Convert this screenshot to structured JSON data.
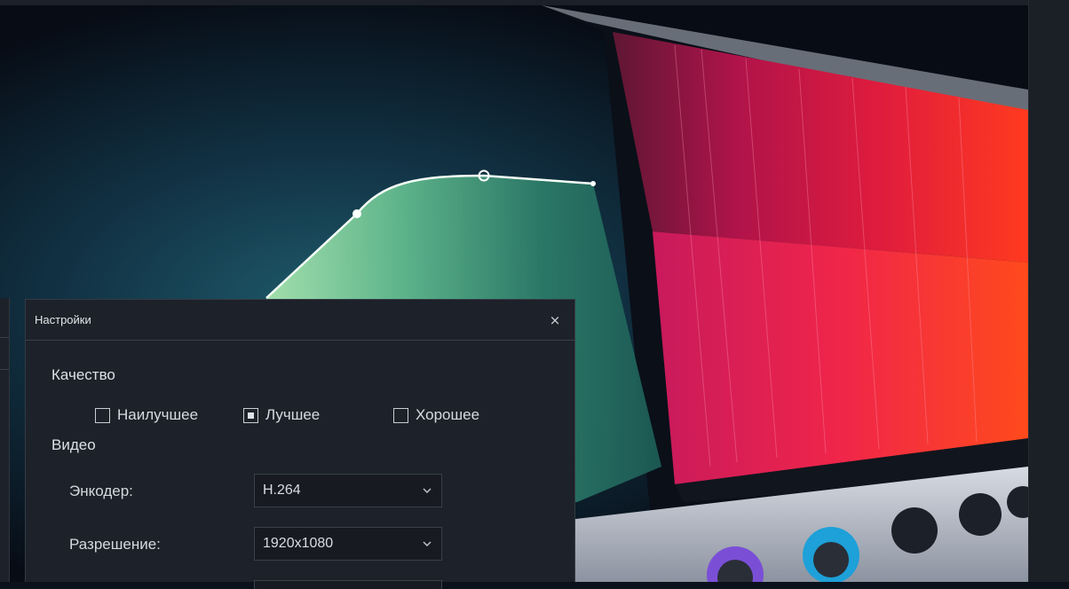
{
  "dialog": {
    "title": "Настройки",
    "close_symbol": "×",
    "quality": {
      "label": "Качество",
      "options": [
        {
          "label": "Наилучшее",
          "checked": false
        },
        {
          "label": "Лучшее",
          "checked": true
        },
        {
          "label": "Хорошее",
          "checked": false
        }
      ]
    },
    "video": {
      "label": "Видео",
      "encoder": {
        "label": "Энкодер:",
        "value": "H.264"
      },
      "resolution": {
        "label": "Разрешение:",
        "value": "1920x1080"
      }
    }
  },
  "icons": {
    "close": "close-icon",
    "dropdown": "chevron-down-icon",
    "checkbox": "checkbox-icon"
  },
  "colors": {
    "dialog_bg": "#1d2129",
    "dialog_border": "#343a44",
    "text": "#d9dce1",
    "select_bg": "#171b21",
    "preview_bg": "#0c121b"
  }
}
